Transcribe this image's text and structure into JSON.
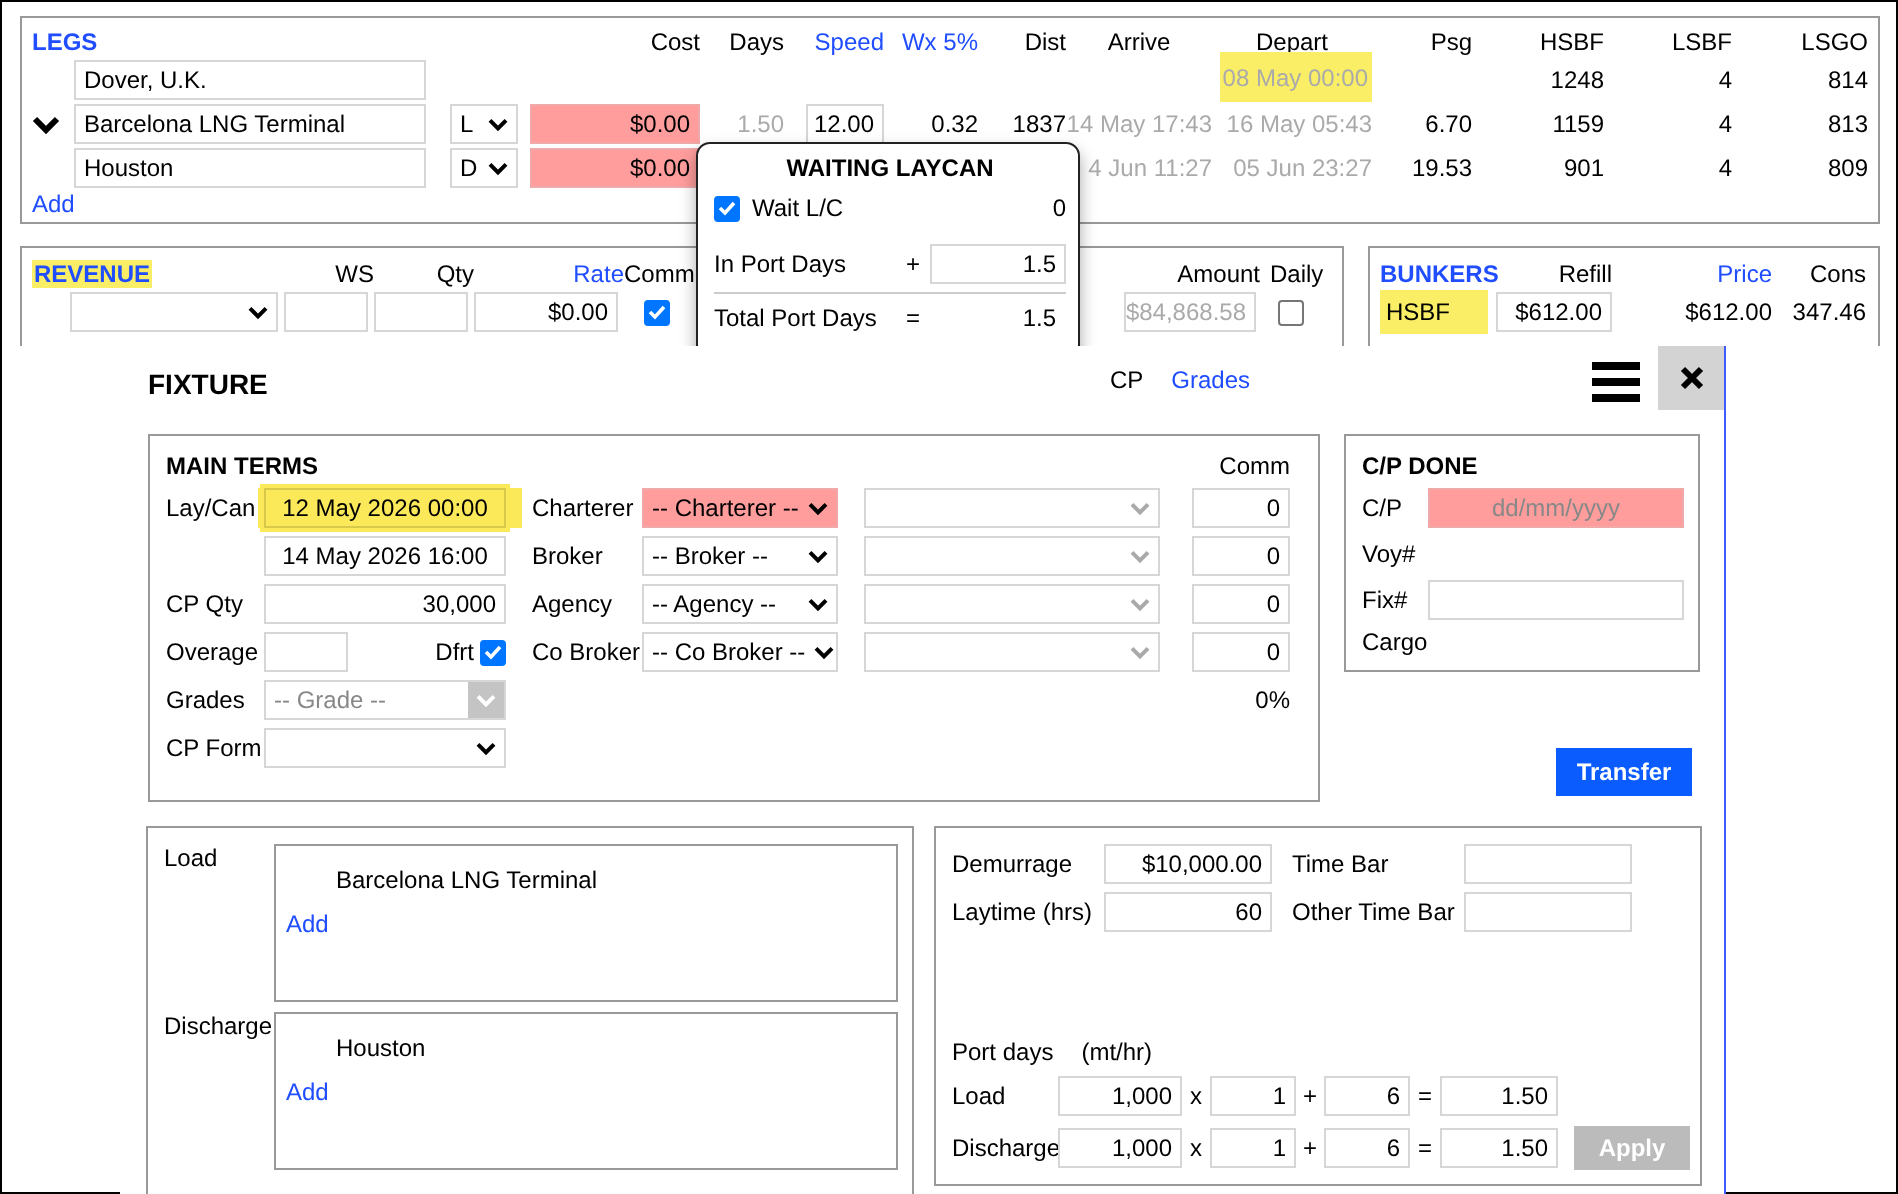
{
  "legs": {
    "title": "LEGS",
    "columns": [
      {
        "label": "Cost",
        "link": false
      },
      {
        "label": "Days",
        "link": false
      },
      {
        "label": "Speed",
        "link": true
      },
      {
        "label": "Wx 5%",
        "link": true
      },
      {
        "label": "Dist",
        "link": false
      },
      {
        "label": "Arrive",
        "link": false
      },
      {
        "label": "Depart",
        "link": false
      },
      {
        "label": "Psg",
        "link": false
      },
      {
        "label": "HSBF",
        "link": false
      },
      {
        "label": "LSBF",
        "link": false
      },
      {
        "label": "LSGO",
        "link": false
      }
    ],
    "rows": [
      {
        "toggle": false,
        "port": "Dover, U.K.",
        "depart": "08 May 00:00",
        "depart_highlighted": true,
        "hsbf": "1248",
        "lsbf": "4",
        "lsgo": "814"
      },
      {
        "toggle": true,
        "port": "Barcelona LNG Terminal",
        "type": "L",
        "cost": "$0.00",
        "cost_invalid": true,
        "days": "1.50",
        "speed": "12.00",
        "wx": "0.32",
        "dist": "1837",
        "arrive": "14 May 17:43",
        "depart": "16 May 05:43",
        "depart_highlighted": false,
        "psg": "6.70",
        "hsbf": "1159",
        "lsbf": "4",
        "lsgo": "813"
      },
      {
        "toggle": false,
        "port": "Houston",
        "type": "D",
        "cost": "$0.00",
        "cost_invalid": true,
        "arrive": "4 Jun 11:27",
        "depart": "05 Jun 23:27",
        "depart_highlighted": false,
        "psg": "19.53",
        "hsbf": "901",
        "lsbf": "4",
        "lsgo": "809"
      }
    ],
    "add": "Add"
  },
  "revenue": {
    "title": "REVENUE",
    "title_highlighted": true,
    "columns": [
      {
        "label": "WS",
        "link": false
      },
      {
        "label": "Qty",
        "link": false
      },
      {
        "label": "Rate",
        "link": true
      },
      {
        "label": "Comm",
        "link": false
      },
      {
        "label": "Amount",
        "link": false
      },
      {
        "label": "Daily",
        "link": false
      }
    ],
    "rows": [
      {
        "rate": "$0.00",
        "comm": true,
        "amount": "$84,868.58",
        "amount_disabled": true,
        "daily": false
      }
    ]
  },
  "bunkers": {
    "title": "BUNKERS",
    "columns": [
      {
        "label": "Refill",
        "link": false
      },
      {
        "label": "Price",
        "link": true
      },
      {
        "label": "Cons",
        "link": false
      }
    ],
    "rows": [
      {
        "grade": "HSBF",
        "highlighted": true,
        "refill": "$612.00",
        "price": "$612.00",
        "cons": "347.46"
      }
    ]
  },
  "laycan_popup": {
    "title": "WAITING LAYCAN",
    "wait": {
      "label": "Wait L/C",
      "checked": true,
      "value": "0"
    },
    "in_port": {
      "label": "In Port Days",
      "op": "+",
      "value": "1.5"
    },
    "total": {
      "label": "Total Port Days",
      "op": "=",
      "value": "1.5"
    }
  },
  "fixture": {
    "title": "FIXTURE",
    "tabs": [
      {
        "label": "CP",
        "selected": true
      },
      {
        "label": "Grades",
        "selected": false
      }
    ],
    "main_terms": {
      "title": "MAIN TERMS",
      "comm_header": "Comm",
      "laycan": {
        "label": "Lay/Can",
        "from": "12 May 2026 00:00",
        "to": "14 May 2026 16:00",
        "highlighted": true
      },
      "cp_qty": {
        "label": "CP Qty",
        "value": "30,000"
      },
      "overage": {
        "label": "Overage",
        "dfrt_label": "Dfrt",
        "dfrt_checked": true
      },
      "grades": {
        "label": "Grades",
        "placeholder": "-- Grade --",
        "disabled": true
      },
      "cp_form": {
        "label": "CP Form"
      },
      "parties": [
        {
          "label": "Charterer",
          "value": "-- Charterer --",
          "required": true,
          "comm": "0"
        },
        {
          "label": "Broker",
          "value": "-- Broker --",
          "required": false,
          "comm": "0"
        },
        {
          "label": "Agency",
          "value": "-- Agency --",
          "required": false,
          "comm": "0"
        },
        {
          "label": "Co Broker",
          "value": "-- Co Broker --",
          "required": false,
          "comm": "0"
        }
      ],
      "comm_total": "0%"
    },
    "cp_done": {
      "title": "C/P DONE",
      "fields": [
        {
          "label": "C/P",
          "kind": "date",
          "placeholder": "dd/mm/yyyy",
          "required": true
        },
        {
          "label": "Voy#",
          "kind": "label"
        },
        {
          "label": "Fix#",
          "kind": "input"
        },
        {
          "label": "Cargo",
          "kind": "label"
        }
      ]
    },
    "transfer": "Transfer",
    "ports": [
      {
        "label": "Load",
        "items": [
          "Barcelona LNG Terminal"
        ],
        "add": "Add"
      },
      {
        "label": "Discharge",
        "items": [
          "Houston"
        ],
        "add": "Add"
      }
    ],
    "terms": [
      {
        "label": "Demurrage",
        "value": "$10,000.00"
      },
      {
        "label": "Time Bar"
      },
      {
        "label": "Laytime (hrs)",
        "value": "60"
      },
      {
        "label": "Other Time Bar"
      }
    ],
    "port_days": {
      "title": "Port days",
      "unit": "(mt/hr)",
      "rows": [
        {
          "label": "Load",
          "operators": [
            "x",
            "+",
            "="
          ],
          "rate": "1,000",
          "factor": "1",
          "extra": "6",
          "result": "1.50"
        },
        {
          "label": "Discharge",
          "operators": [
            "x",
            "+",
            "="
          ],
          "rate": "1,000",
          "factor": "1",
          "extra": "6",
          "result": "1.50"
        }
      ],
      "apply": {
        "label": "Apply",
        "disabled": true
      }
    }
  }
}
